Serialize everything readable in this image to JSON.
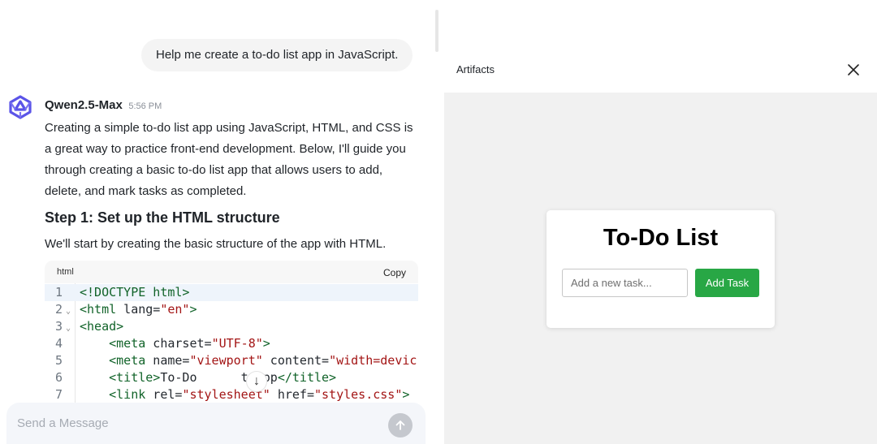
{
  "chat": {
    "user_message": "Help me create a to-do list app in JavaScript.",
    "model_name": "Qwen2.5-Max",
    "time": "5:56 PM",
    "intro_lines": [
      "Creating a simple to-do list app using JavaScript, HTML, and CSS is",
      "a great way to practice front-end development. Below, I'll guide you",
      "through creating a basic to-do list app that allows users to add,",
      "delete, and mark tasks as completed."
    ],
    "step_title": "Step 1: Set up the HTML structure",
    "step_desc": "We'll start by creating the basic structure of the app with HTML.",
    "code": {
      "lang": "html",
      "copy_label": "Copy",
      "scroll_icon": "↓",
      "line_numbers": [
        "1",
        "2",
        "3",
        "4",
        "5",
        "6",
        "7"
      ],
      "lines": [
        [
          [
            "tag",
            "<!DOCTYPE html>"
          ]
        ],
        [
          [
            "tag",
            "<html"
          ],
          [
            "attr",
            " lang="
          ],
          [
            "str",
            "\"en\""
          ],
          [
            "tag",
            ">"
          ]
        ],
        [
          [
            "tag",
            "<head>"
          ]
        ],
        [
          [
            "plain",
            "    "
          ],
          [
            "tag",
            "<meta"
          ],
          [
            "attr",
            " charset="
          ],
          [
            "str",
            "\"UTF-8\""
          ],
          [
            "tag",
            ">"
          ]
        ],
        [
          [
            "plain",
            "    "
          ],
          [
            "tag",
            "<meta"
          ],
          [
            "attr",
            " name="
          ],
          [
            "str",
            "\"viewport\""
          ],
          [
            "attr",
            " content="
          ],
          [
            "str",
            "\"width=devic"
          ]
        ],
        [
          [
            "plain",
            "    "
          ],
          [
            "tag",
            "<title>"
          ],
          [
            "plain",
            "To-Do      t App"
          ],
          [
            "tag",
            "</title>"
          ]
        ],
        [
          [
            "plain",
            "    "
          ],
          [
            "tag",
            "<link"
          ],
          [
            "attr",
            " rel="
          ],
          [
            "str",
            "\"stylesheet\""
          ],
          [
            "attr",
            " href="
          ],
          [
            "str",
            "\"styles.css\""
          ],
          [
            "tag",
            ">"
          ]
        ]
      ]
    },
    "composer_placeholder": "Send a Message"
  },
  "artifacts": {
    "title": "Artifacts",
    "close_icon": "close-icon",
    "app": {
      "heading": "To-Do List",
      "input_placeholder": "Add a new task...",
      "button_label": "Add Task",
      "button_color": "#28a745"
    }
  }
}
